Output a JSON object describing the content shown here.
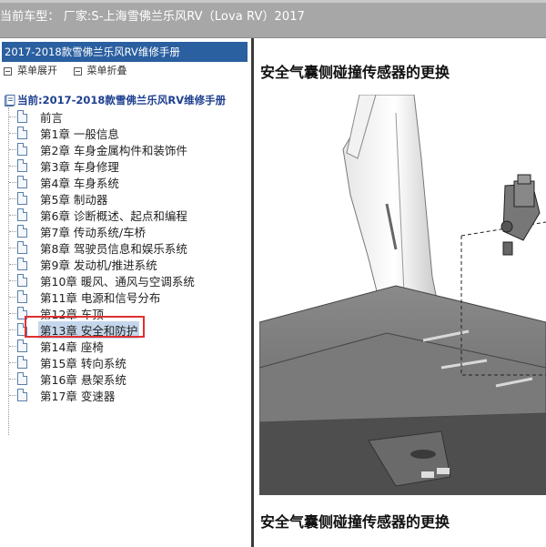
{
  "window": {
    "title_bar": "当前车型：  厂家:S-上海雪佛兰乐风RV（Lova RV）2017"
  },
  "sidebar": {
    "header": "2017-2018款雪佛兰乐风RV维修手册",
    "expand_label": "菜单展开",
    "collapse_label": "菜单折叠",
    "root_label": "当前:2017-2018款雪佛兰乐风RV维修手册",
    "items": [
      {
        "label": "前言"
      },
      {
        "label": "第1章 一般信息"
      },
      {
        "label": "第2章 车身金属构件和装饰件"
      },
      {
        "label": "第3章 车身修理"
      },
      {
        "label": "第4章 车身系统"
      },
      {
        "label": "第5章 制动器"
      },
      {
        "label": "第6章 诊断概述、起点和编程"
      },
      {
        "label": "第7章 传动系统/车桥"
      },
      {
        "label": "第8章 驾驶员信息和娱乐系统"
      },
      {
        "label": "第9章 发动机/推进系统"
      },
      {
        "label": "第10章 暖风、通风与空调系统"
      },
      {
        "label": "第11章 电源和信号分布"
      },
      {
        "label": "第12章 车顶"
      },
      {
        "label": "第13章 安全和防护"
      },
      {
        "label": "第14章 座椅"
      },
      {
        "label": "第15章 转向系统"
      },
      {
        "label": "第16章 悬架系统"
      },
      {
        "label": "第17章 变速器"
      }
    ],
    "selected_index": 13
  },
  "content": {
    "title": "安全气囊侧碰撞传感器的更换",
    "caption_title": "安全气囊侧碰撞传感器的更换"
  },
  "colors": {
    "topbar": "#a7a7a7",
    "header_bg": "#2a5fa0",
    "selection": "#c5d7ec",
    "highlight": "#e03030"
  }
}
